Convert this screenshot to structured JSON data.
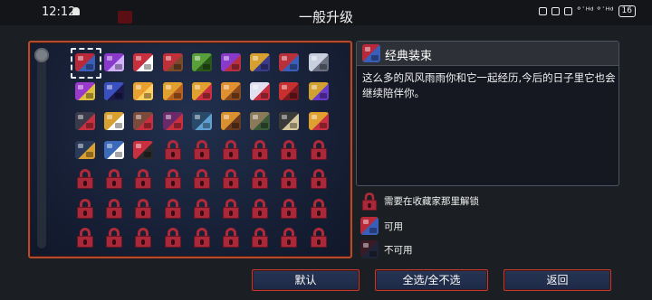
{
  "status_bar": {
    "time": "12:12",
    "right_text": "°˙ᴴᵈ °˙ᴴᵈ",
    "battery": "16"
  },
  "screen_title": "一般升级",
  "colors": {
    "accent_border": "#b84a2c",
    "lock_red": "#a9283a",
    "panel_bg": "#172036"
  },
  "grid": {
    "columns": 9,
    "items": [
      {
        "kind": "armor",
        "colors": [
          "#b82a3a",
          "#3a5fb8"
        ],
        "selected": true
      },
      {
        "kind": "armor",
        "colors": [
          "#8a3acb",
          "#d0b0ff"
        ]
      },
      {
        "kind": "armor",
        "colors": [
          "#c83040",
          "#ffffff"
        ]
      },
      {
        "kind": "armor",
        "colors": [
          "#c0303a",
          "#7a4a2a"
        ]
      },
      {
        "kind": "armor",
        "colors": [
          "#5aa03a",
          "#2a5a1a"
        ]
      },
      {
        "kind": "armor",
        "colors": [
          "#8a3acb",
          "#b83040"
        ]
      },
      {
        "kind": "armor",
        "colors": [
          "#d8a030",
          "#3a3a8a"
        ]
      },
      {
        "kind": "armor",
        "colors": [
          "#b8303a",
          "#3a5fb8"
        ]
      },
      {
        "kind": "armor",
        "colors": [
          "#c8d0e0",
          "#6a7080"
        ]
      },
      {
        "kind": "armor",
        "colors": [
          "#9a3acb",
          "#e0c040"
        ]
      },
      {
        "kind": "armor",
        "colors": [
          "#3a4fc0",
          "#1a1a4a"
        ]
      },
      {
        "kind": "armor",
        "colors": [
          "#e8a030",
          "#ffd060"
        ]
      },
      {
        "kind": "armor",
        "colors": [
          "#e0a030",
          "#b86020"
        ]
      },
      {
        "kind": "armor",
        "colors": [
          "#e0a030",
          "#c83040"
        ]
      },
      {
        "kind": "armor",
        "colors": [
          "#e09030",
          "#8a4a20"
        ]
      },
      {
        "kind": "armor",
        "colors": [
          "#e0e0f0",
          "#c83040"
        ]
      },
      {
        "kind": "armor",
        "colors": [
          "#c83030",
          "#7a1a20"
        ]
      },
      {
        "kind": "armor",
        "colors": [
          "#d0a030",
          "#6a3acb"
        ]
      },
      {
        "kind": "armor",
        "colors": [
          "#3a3a4a",
          "#c83040"
        ]
      },
      {
        "kind": "armor",
        "colors": [
          "#d8a030",
          "#ffffff"
        ]
      },
      {
        "kind": "armor",
        "colors": [
          "#7a4a3a",
          "#c83040"
        ]
      },
      {
        "kind": "armor",
        "colors": [
          "#6a2a6a",
          "#c83040"
        ]
      },
      {
        "kind": "armor",
        "colors": [
          "#2a4a6a",
          "#60a0d0"
        ]
      },
      {
        "kind": "armor",
        "colors": [
          "#d89030",
          "#6a3a20"
        ]
      },
      {
        "kind": "armor",
        "colors": [
          "#8a7a5a",
          "#3a5a3a"
        ]
      },
      {
        "kind": "armor",
        "colors": [
          "#3a3a3a",
          "#d8c8a0"
        ]
      },
      {
        "kind": "armor",
        "colors": [
          "#e0a030",
          "#c83040"
        ]
      },
      {
        "kind": "armor",
        "colors": [
          "#2a3a5a",
          "#d8a030"
        ]
      },
      {
        "kind": "armor",
        "colors": [
          "#3a6ab8",
          "#ffffff"
        ]
      },
      {
        "kind": "armor",
        "colors": [
          "#c83040",
          "#2a2a2a"
        ]
      },
      {
        "kind": "lock"
      },
      {
        "kind": "lock"
      },
      {
        "kind": "lock"
      },
      {
        "kind": "lock"
      },
      {
        "kind": "lock"
      },
      {
        "kind": "lock"
      },
      {
        "kind": "lock"
      },
      {
        "kind": "lock"
      },
      {
        "kind": "lock"
      },
      {
        "kind": "lock"
      },
      {
        "kind": "lock"
      },
      {
        "kind": "lock"
      },
      {
        "kind": "lock"
      },
      {
        "kind": "lock"
      },
      {
        "kind": "lock"
      },
      {
        "kind": "lock"
      },
      {
        "kind": "lock"
      },
      {
        "kind": "lock"
      },
      {
        "kind": "lock"
      },
      {
        "kind": "lock"
      },
      {
        "kind": "lock"
      },
      {
        "kind": "lock"
      },
      {
        "kind": "lock"
      },
      {
        "kind": "lock"
      },
      {
        "kind": "lock"
      },
      {
        "kind": "lock"
      },
      {
        "kind": "lock"
      },
      {
        "kind": "lock"
      },
      {
        "kind": "lock"
      },
      {
        "kind": "lock"
      },
      {
        "kind": "lock"
      },
      {
        "kind": "lock"
      },
      {
        "kind": "lock"
      },
      {
        "kind": "lock"
      },
      {
        "kind": "lock"
      },
      {
        "kind": "lock"
      },
      {
        "kind": "lock"
      },
      {
        "kind": "lock"
      },
      {
        "kind": "lock"
      },
      {
        "kind": "lock"
      },
      {
        "kind": "lock"
      },
      {
        "kind": "lock"
      }
    ]
  },
  "description": {
    "title": "经典装束",
    "body": "这么多的风风雨雨你和它一起经历,今后的日子里它也会继续陪伴你。"
  },
  "legend": [
    {
      "kind": "lock",
      "label": "需要在收藏家那里解锁"
    },
    {
      "kind": "available",
      "label": "可用"
    },
    {
      "kind": "unavailable",
      "label": "不可用"
    }
  ],
  "buttons": {
    "default": "默认",
    "select_all": "全选/全不选",
    "back": "返回"
  }
}
